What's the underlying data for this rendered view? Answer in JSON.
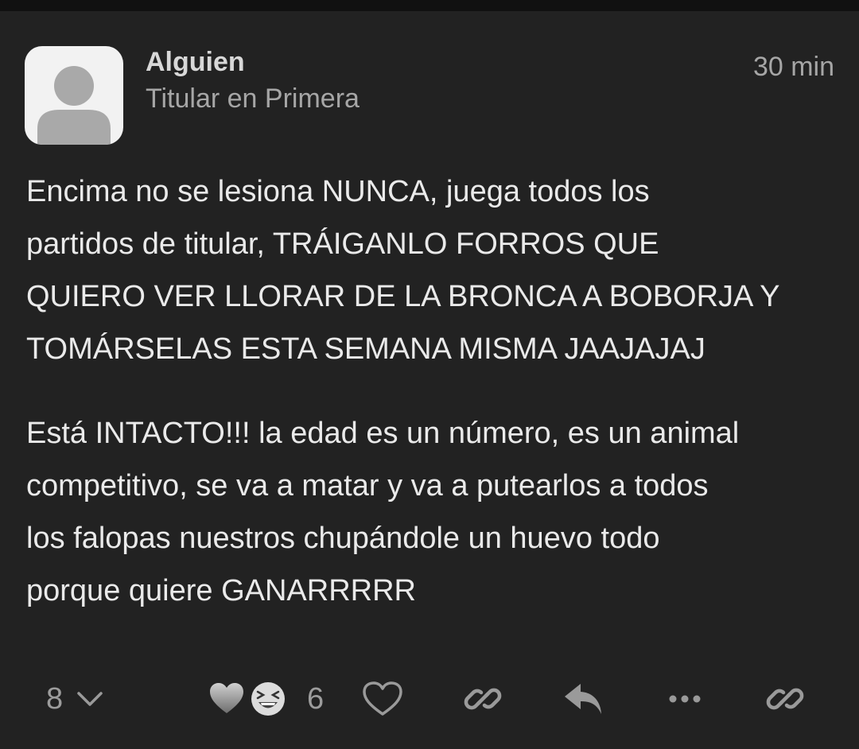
{
  "post": {
    "author_name": "Alguien",
    "author_title": "Titular en Primera",
    "time": "30 min",
    "paragraphs": [
      "Encima no se lesiona NUNCA, juega todos los\npartidos de titular, TRÁIGANLO FORROS QUE\nQUIERO VER LLORAR DE LA BRONCA A BOBORJA Y\nTOMÁRSELAS ESTA SEMANA MISMA JAAJAJAJ",
      "Está INTACTO!!! la edad es un número, es un animal\ncompetitivo, se va a matar y va a putearlos a todos\nlos falopas nuestros chupándole un huevo todo\nporque quiere GANARRRRR"
    ]
  },
  "actions": {
    "replies_count": "8",
    "reactions_count": "6",
    "icons": [
      "chevron-down-icon",
      "grey-heart-emoji",
      "laughing-emoji",
      "heart-outline-icon",
      "link-icon",
      "reply-icon",
      "more-icon",
      "link-icon"
    ]
  },
  "colors": {
    "background": "#222222",
    "top_bar": "#111111",
    "text": "#eaeaea",
    "muted": "#a6a6a6"
  }
}
